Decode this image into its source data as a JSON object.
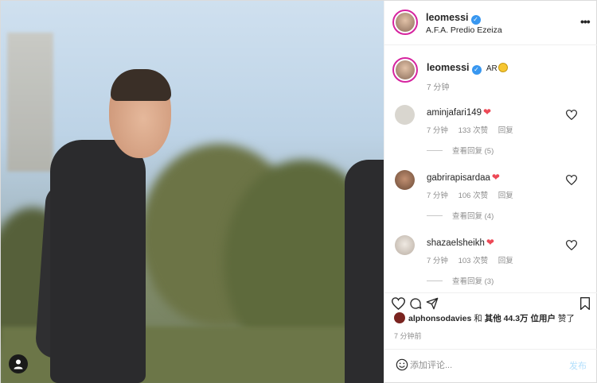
{
  "header": {
    "username": "leomessi",
    "location": "A.F.A. Predio Ezeiza",
    "more_icon": "more-horizontal-icon"
  },
  "caption": {
    "username": "leomessi",
    "text": "AR",
    "time": "7 分钟"
  },
  "comments": [
    {
      "username": "aminjafari149",
      "time": "7 分钟",
      "likes": "133 次赞",
      "reply": "回复",
      "view_replies": "查看回复 (5)",
      "avatar_color": "#d9d6cf"
    },
    {
      "username": "gabrirapisardaa",
      "time": "7 分钟",
      "likes": "106 次赞",
      "reply": "回复",
      "view_replies": "查看回复 (4)",
      "avatar_color": "#a3785c"
    },
    {
      "username": "shazaelsheikh",
      "time": "7 分钟",
      "likes": "103 次赞",
      "reply": "回复",
      "view_replies": "查看回复 (3)",
      "avatar_color": "#cfc9c1"
    }
  ],
  "likes": {
    "first_user": "alphonsodavies",
    "conj": "和",
    "others": "其他 44.3万 位用户",
    "suffix": "赞了"
  },
  "post_time": "7 分钟前",
  "add_comment": {
    "placeholder": "添加评论...",
    "post_label": "发布"
  },
  "colors": {
    "verified": "#3897f0",
    "heart": "#ed4956",
    "post_button": "#b2dffc"
  }
}
